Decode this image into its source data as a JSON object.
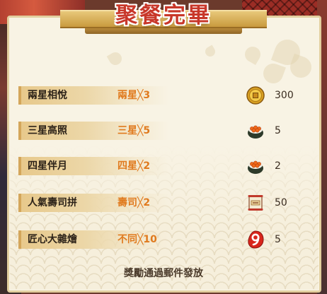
{
  "title": "聚餐完畢",
  "rewards": [
    {
      "name": "兩星相悅",
      "requirement": "兩星╳3",
      "reward_icon": "gold-coin-icon",
      "count": "300"
    },
    {
      "name": "三星高照",
      "requirement": "三星╳5",
      "reward_icon": "salmon-roe-sushi-icon",
      "count": "5"
    },
    {
      "name": "四星伴月",
      "requirement": "四星╳2",
      "reward_icon": "salmon-roe-sushi-icon",
      "count": "2"
    },
    {
      "name": "人氣壽司拼",
      "requirement": "壽司╳2",
      "reward_icon": "scroll-ticket-icon",
      "count": "50"
    },
    {
      "name": "匠心大雜燴",
      "requirement": "不同╳10",
      "reward_icon": "number-nine-badge-icon",
      "count": "5"
    }
  ],
  "footer": "獎勵通過郵件發放",
  "colors": {
    "title": "#c8372a",
    "requirement": "#e07a1e",
    "panel": "#f6efdc",
    "banner": "#e7c88a"
  }
}
